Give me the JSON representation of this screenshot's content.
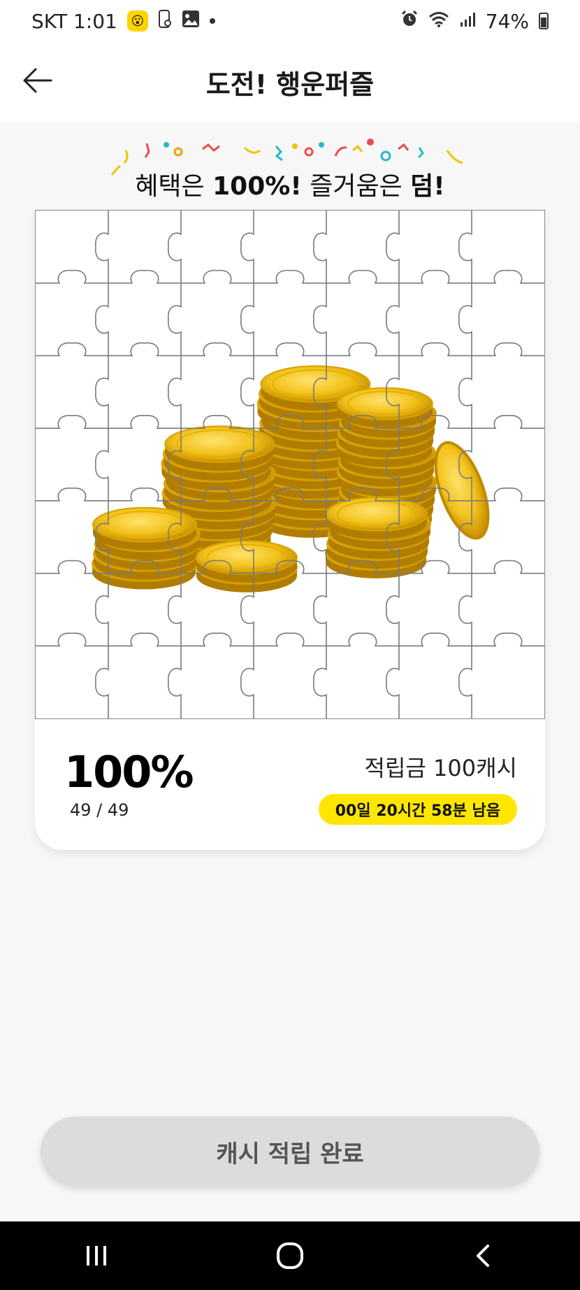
{
  "status_bar": {
    "carrier_time": "SKT 1:01",
    "battery": "74%",
    "icons": [
      "emoji-notification-icon",
      "phone-storage-icon",
      "image-icon",
      "dot-icon",
      "alarm-icon",
      "wifi-icon",
      "signal-icon",
      "battery-icon"
    ]
  },
  "header": {
    "title": "도전! 행운퍼즐",
    "back_icon": "arrow-left-icon"
  },
  "banner": {
    "prefix": "혜택은 ",
    "bold1": "100%!",
    "middle": " 즐거움은 ",
    "bold2": "덤!"
  },
  "puzzle": {
    "rows": 7,
    "cols": 7,
    "image": "gold-coins-stack",
    "percent": "100%",
    "count": "49 / 49",
    "reward": "적립금 100캐시",
    "time_left": "00일 20시간 58분 남음"
  },
  "cta": {
    "label": "캐시 적립 완료"
  },
  "nav": {
    "icons": [
      "recent-apps-icon",
      "home-icon",
      "back-icon"
    ]
  },
  "colors": {
    "accent": "#ffe600",
    "cta_bg": "#dcdcdc",
    "coin": "#f2c21c"
  }
}
